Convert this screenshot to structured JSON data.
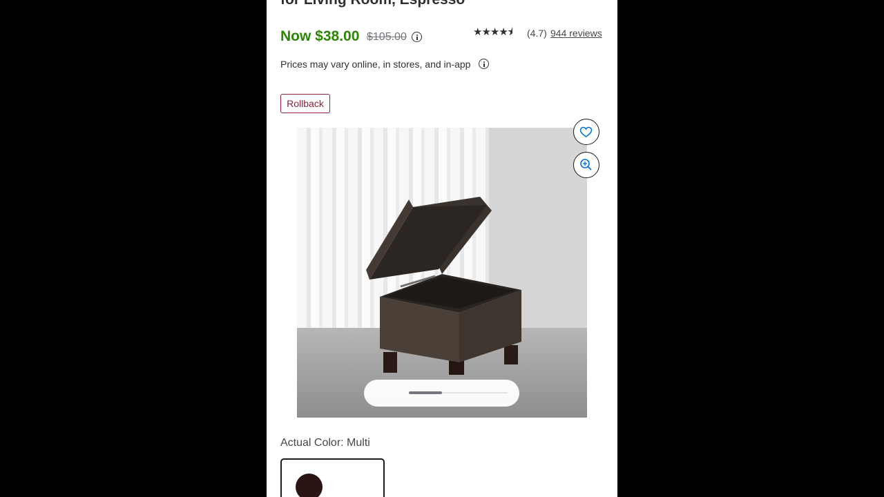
{
  "product": {
    "title_fragment": "for Living Room, Espresso",
    "price_now": "Now $38.00",
    "price_was": "$105.00",
    "rating_stars": "★★★★⯨",
    "rating_value": "(4.7)",
    "reviews_link": "944 reviews",
    "price_note": "Prices may vary online, in stores, and in-app",
    "badge": "Rollback",
    "actual_color_label": "Actual Color: Multi"
  },
  "icons": {
    "favorite": "heart-icon",
    "zoom": "zoom-in-icon",
    "info": "info-icon"
  },
  "colors": {
    "price_green": "#2a8703",
    "rollback_red": "#8e2137",
    "accent_blue": "#0071dc"
  },
  "gallery": {
    "active_index": 1
  }
}
